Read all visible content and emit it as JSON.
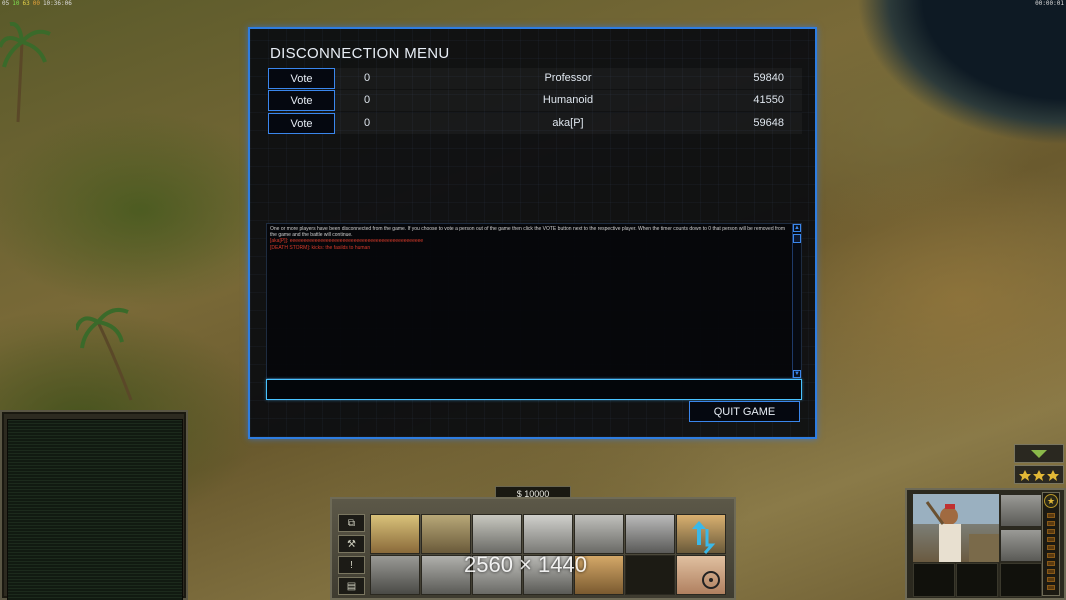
{
  "hud": {
    "top_left": [
      "05",
      "10",
      "63",
      "00",
      "10:36:06"
    ],
    "top_right": "00:00:01"
  },
  "dialog": {
    "title": "DISCONNECTION MENU",
    "vote_label": "Vote",
    "players": [
      {
        "votes": "0",
        "name": "Professor",
        "score": "59840"
      },
      {
        "votes": "0",
        "name": "Humanoid",
        "score": "41550"
      },
      {
        "votes": "0",
        "name": "aka[P]",
        "score": "59648"
      }
    ],
    "chat_lines": [
      "One or more players have been disconnected from the game. If you choose to vote a person out of the game then click the VOTE button next to the respective player. When the timer counts down to 0 that person will be removed from the game and the battle will continue."
    ],
    "chat_lines_red": [
      "[aka[P]]: eeeeeeeeeeeeeeeeeeeeeeeeeeeeeeeeeeeeeeeeeeeeeeee",
      "[DEATH STORM]: kicks: the fasilds to human"
    ],
    "chat_input_value": "",
    "quit_label": "QUIT GAME"
  },
  "cmdbar": {
    "money": "$ 10000",
    "side_buttons": [
      "⧉",
      "⚒",
      "!",
      "▤"
    ]
  },
  "watermark": "2560 × 1440",
  "colors": {
    "accent_blue": "#2e7de0",
    "input_cyan": "#49c3ff",
    "chat_red": "#d83a2a",
    "rank_gold": "#e2b836"
  }
}
